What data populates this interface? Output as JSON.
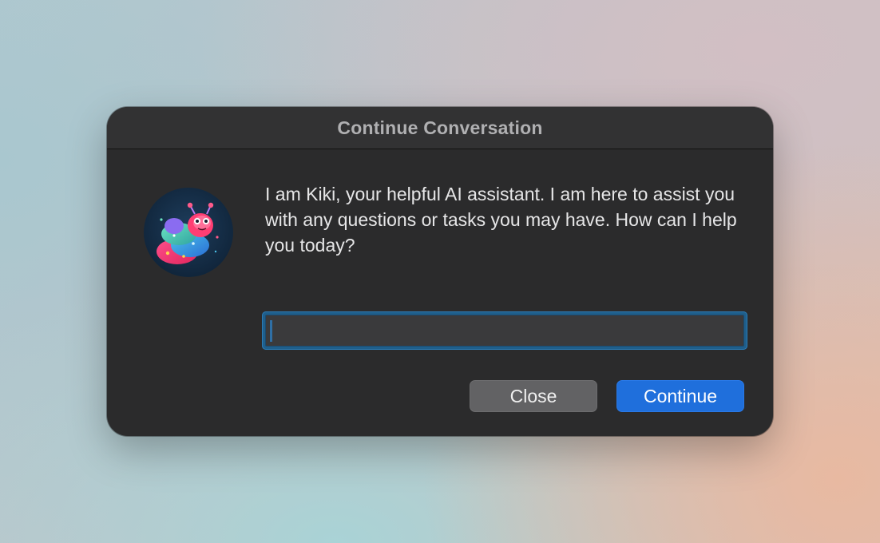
{
  "dialog": {
    "title": "Continue Conversation",
    "message": "I am Kiki, your helpful AI assistant. I am here to assist you with any questions or tasks you may have. How can I help you today?",
    "input": {
      "value": "",
      "placeholder": ""
    },
    "buttons": {
      "close_label": "Close",
      "continue_label": "Continue"
    },
    "avatar_icon": "kiki-worm-avatar-icon"
  },
  "colors": {
    "dialog_background": "#2b2b2c",
    "accent_blue": "#1f6fdc",
    "secondary_button": "#626264",
    "input_focus_ring": "#1f5f8c"
  }
}
